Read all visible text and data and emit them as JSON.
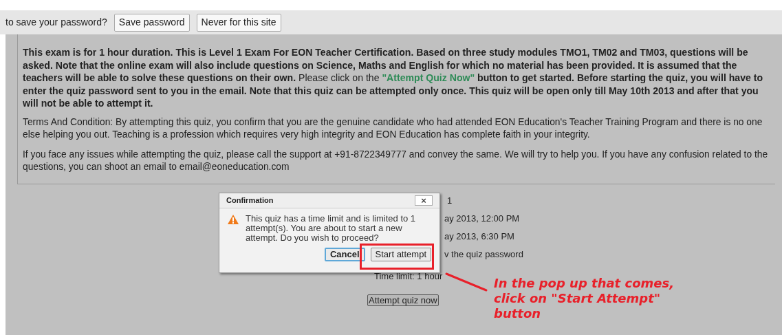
{
  "password_bar": {
    "prompt": "to save your password?",
    "buttons": [
      {
        "label": "Save password"
      },
      {
        "label": "Never for this site"
      }
    ]
  },
  "instructions": {
    "intro_paragraph": [
      {
        "kind": "bold",
        "text": "This exam is for 1 hour duration. This is Level 1 Exam For EON Teacher Certification.  Based on three study modules TMO1, TM02 and TM03, questions will be asked. Note that the online exam will also include questions on Science, Maths and English for which no material has been provided. It is assumed that the teachers will be able to solve these questions on their own."
      },
      {
        "kind": "normal",
        "text": " Please click on the "
      },
      {
        "kind": "highlight",
        "text": "\"Attempt Quiz Now\""
      },
      {
        "kind": "bold",
        "text": " button to get started. Before starting the quiz, you will have to enter the quiz password sent to you in the email. Note that this quiz can be attempted only once. This quiz will be open only till May 10th 2013 and after that you will not be able to attempt it."
      }
    ],
    "terms_paragraph": "Terms And Condition:  By attempting this quiz, you confirm that you are the genuine candidate who had attended EON Education's Teacher Training Program and there is no one else helping you out. Teaching is a profession which requires very high integrity and EON Education has complete faith in your integrity.",
    "support_paragraph": "If you face any issues while attempting the quiz, please call the support at +91-8722349777 and convey the same. We will try to help you. If you have any confusion related to the questions, you can shoot an email to email@eoneducation.com"
  },
  "quiz_info": [
    "1",
    "ay 2013, 12:00 PM",
    "ay 2013, 6:30 PM",
    "v the quiz password",
    "Time limit: 1 hour"
  ],
  "attempt_button": "Attempt quiz now",
  "dialog": {
    "title": "Confirmation",
    "close": "×",
    "message": "This quiz has a time limit and is limited to 1 attempt(s). You are about to start a new attempt. Do you wish to proceed?",
    "buttons": [
      {
        "label": "Cancel",
        "kind": "default"
      },
      {
        "label": "Start attempt",
        "kind": "normal"
      }
    ]
  },
  "annotation": "In the pop up that comes, click on \"Start Attempt\" button"
}
